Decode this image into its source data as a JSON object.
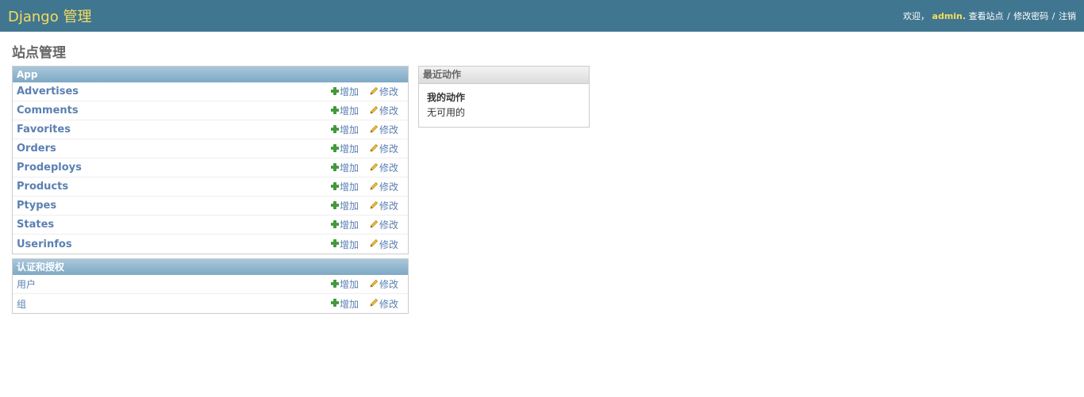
{
  "header": {
    "branding": "Django 管理",
    "welcome": "欢迎，",
    "username": "admin.",
    "view_site": "查看站点",
    "change_password": "修改密码",
    "logout": "注销",
    "separator": "/"
  },
  "page": {
    "title": "站点管理"
  },
  "modules": {
    "app": {
      "caption": "App",
      "rows": [
        {
          "name": "Advertises"
        },
        {
          "name": "Comments"
        },
        {
          "name": "Favorites"
        },
        {
          "name": "Orders"
        },
        {
          "name": "Prodeploys"
        },
        {
          "name": "Products"
        },
        {
          "name": "Ptypes"
        },
        {
          "name": "States"
        },
        {
          "name": "Userinfos"
        }
      ]
    },
    "auth": {
      "caption": "认证和授权",
      "rows": [
        {
          "name": "用户"
        },
        {
          "name": "组"
        }
      ]
    }
  },
  "actions": {
    "add": "增加",
    "change": "修改"
  },
  "recent": {
    "caption": "最近动作",
    "heading": "我的动作",
    "empty_text": "无可用的"
  },
  "colors": {
    "header_bg": "#417690",
    "branding": "#f5dd5d",
    "link": "#5b80b2",
    "caption_bg": "#7ea9c4"
  },
  "icons": {
    "add": "plus-icon",
    "change": "pencil-icon"
  }
}
